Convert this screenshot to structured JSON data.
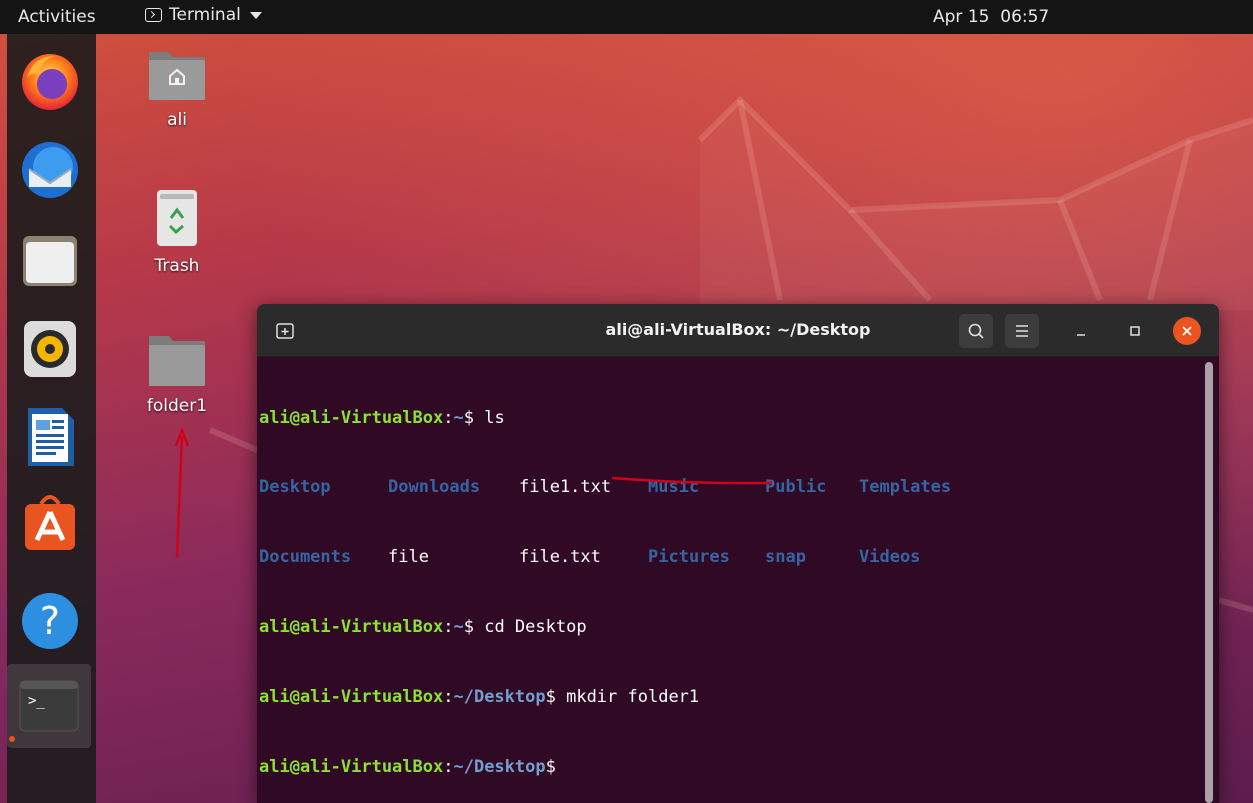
{
  "topbar": {
    "activities": "Activities",
    "app_name": "Terminal",
    "clock": "Apr 15  06:57"
  },
  "dock": {
    "items": [
      {
        "name": "firefox"
      },
      {
        "name": "thunderbird"
      },
      {
        "name": "files"
      },
      {
        "name": "rhythmbox"
      },
      {
        "name": "libreoffice-writer"
      },
      {
        "name": "ubuntu-software"
      },
      {
        "name": "help"
      },
      {
        "name": "terminal"
      }
    ]
  },
  "desktop_icons": {
    "home": {
      "label": "ali"
    },
    "trash": {
      "label": "Trash"
    },
    "folder1": {
      "label": "folder1"
    }
  },
  "terminal": {
    "title": "ali@ali-VirtualBox: ~/Desktop",
    "prompt_user": "ali@ali-VirtualBox",
    "prompt_colon": ":",
    "lines": [
      {
        "path": "~",
        "cmd": " ls"
      },
      {
        "path": "~",
        "cmd": " cd Desktop"
      },
      {
        "path": "~/Desktop",
        "cmd": " mkdir folder1"
      },
      {
        "path": "~/Desktop",
        "cmd": ""
      }
    ],
    "ls_row1": [
      "Desktop",
      "Downloads",
      "file1.txt",
      "Music",
      "Public",
      "Templates"
    ],
    "ls_row2": [
      "Documents",
      "file",
      "file.txt",
      "Pictures",
      "snap",
      "Videos"
    ]
  },
  "colors": {
    "accent": "#e95420",
    "terminal_bg": "#300a24",
    "prompt_user": "#8ae234",
    "prompt_path": "#729fcf",
    "ls_directory": "#3465a4",
    "annotation": "#d0021b"
  }
}
